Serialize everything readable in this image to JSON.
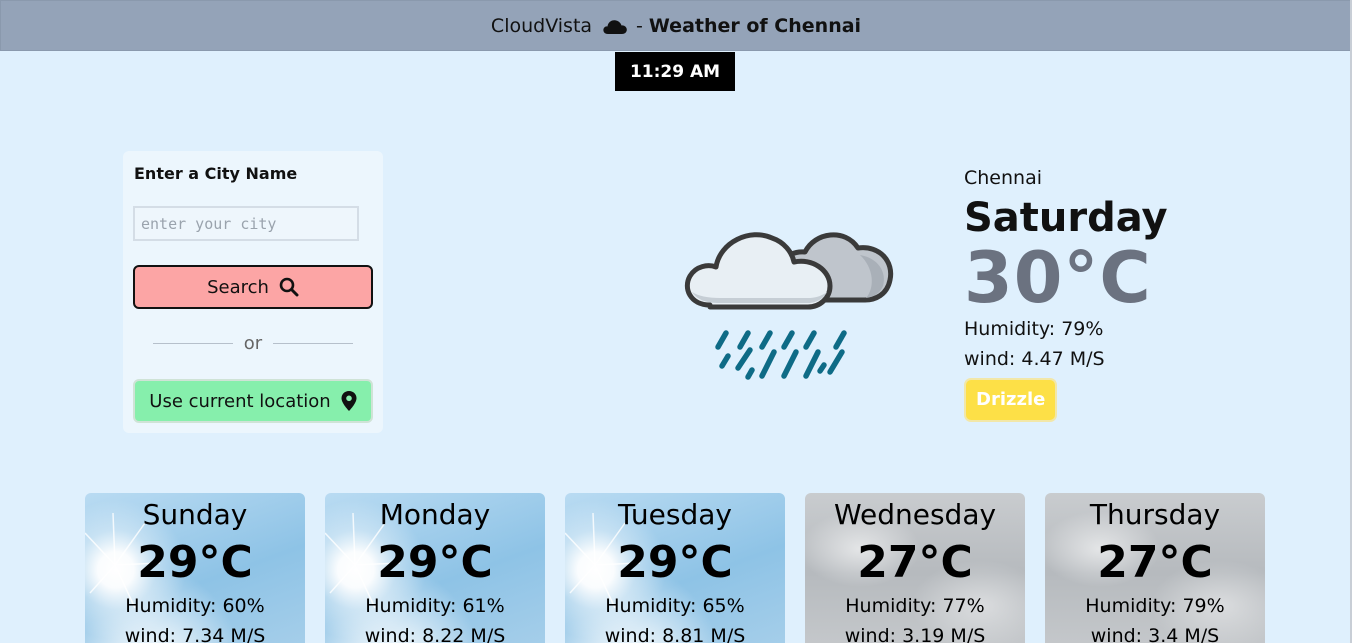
{
  "header": {
    "brand": "CloudVista",
    "separator": "-",
    "title": "Weather of Chennai",
    "icon": "cloud-icon"
  },
  "clock": {
    "time": "11:29 AM"
  },
  "search": {
    "label": "Enter a City Name",
    "placeholder": "enter your city",
    "value": "",
    "search_label": "Search",
    "search_icon": "magnifier-icon",
    "divider_text": "or",
    "location_label": "Use current location",
    "location_icon": "map-pin-icon"
  },
  "current": {
    "city": "Chennai",
    "day": "Saturday",
    "temp": "30°C",
    "humidity": "Humidity: 79%",
    "wind": "wind: 4.47 M/S",
    "condition": "Drizzle",
    "condition_color": "#fde047",
    "icon": "cloud-rain-icon"
  },
  "forecast": [
    {
      "day": "Sunday",
      "temp": "29°C",
      "humidity": "Humidity: 60%",
      "wind": "wind: 7.34 M/S",
      "theme": "sunny"
    },
    {
      "day": "Monday",
      "temp": "29°C",
      "humidity": "Humidity: 61%",
      "wind": "wind: 8.22 M/S",
      "theme": "sunny"
    },
    {
      "day": "Tuesday",
      "temp": "29°C",
      "humidity": "Humidity: 65%",
      "wind": "wind: 8.81 M/S",
      "theme": "sunny"
    },
    {
      "day": "Wednesday",
      "temp": "27°C",
      "humidity": "Humidity: 77%",
      "wind": "wind: 3.19 M/S",
      "theme": "cloudy"
    },
    {
      "day": "Thursday",
      "temp": "27°C",
      "humidity": "Humidity: 79%",
      "wind": "wind: 3.4 M/S",
      "theme": "cloudy"
    }
  ],
  "colors": {
    "page_bg": "#dff0fd",
    "header_bg": "#94a3b8",
    "search_button": "#fca5a5",
    "location_button": "#86efac",
    "rain_drops": "#0e6b86"
  }
}
